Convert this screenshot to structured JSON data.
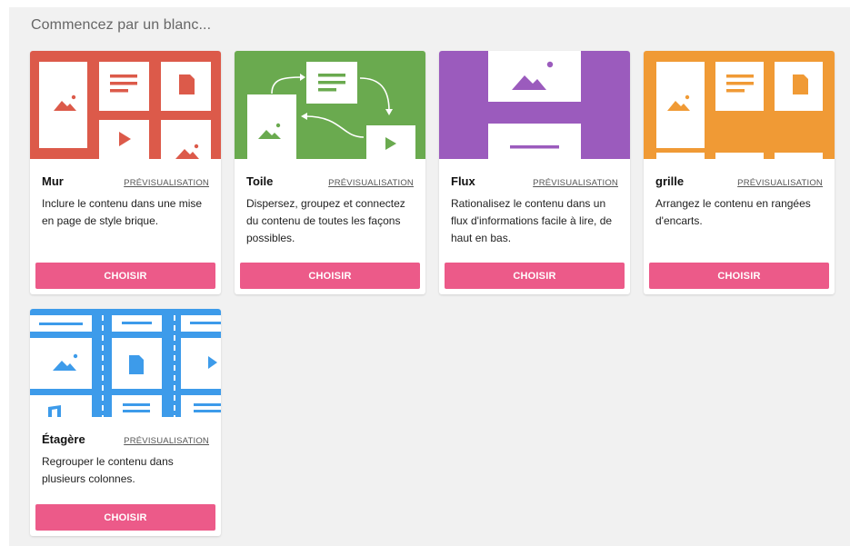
{
  "heading": "Commencez par un blanc...",
  "colors": {
    "mur": "#dc5a4a",
    "toile": "#6aaa4f",
    "flux": "#9b5bbd",
    "grille": "#f09a35",
    "etagere": "#3d9bea",
    "button": "#ec5a89"
  },
  "cards": [
    {
      "title": "Mur",
      "preview": "PRÉVISUALISATION",
      "description": "Inclure le contenu dans une mise en page de style brique.",
      "button": "CHOISIR"
    },
    {
      "title": "Toile",
      "preview": "PRÉVISUALISATION",
      "description": "Dispersez, groupez et connectez du contenu de toutes les façons possibles.",
      "button": "CHOISIR"
    },
    {
      "title": "Flux",
      "preview": "PRÉVISUALISATION",
      "description": "Rationalisez le contenu dans un flux d'informations facile à lire, de haut en bas.",
      "button": "CHOISIR"
    },
    {
      "title": "grille",
      "preview": "PRÉVISUALISATION",
      "description": "Arrangez le contenu en rangées d'encarts.",
      "button": "CHOISIR"
    },
    {
      "title": "Étagère",
      "preview": "PRÉVISUALISATION",
      "description": "Regrouper le contenu dans plusieurs colonnes.",
      "button": "CHOISIR"
    }
  ]
}
